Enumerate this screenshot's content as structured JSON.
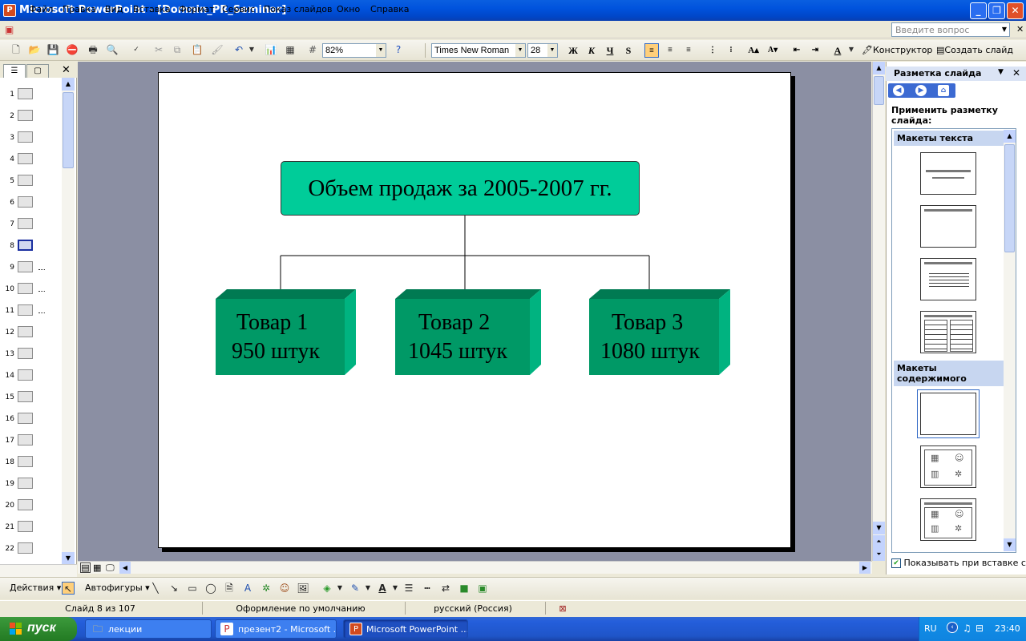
{
  "window": {
    "title": "Microsoft PowerPoint - [Domnin_PR_Seminar]"
  },
  "menu": [
    "Файл",
    "Правка",
    "Вид",
    "Вставка",
    "Формат",
    "Сервис",
    "Показ слайдов",
    "Окно",
    "Справка"
  ],
  "help_placeholder": "Введите вопрос",
  "toolbar": {
    "zoom": "82%",
    "font": "Times New Roman",
    "size": "28",
    "bold": "Ж",
    "italic": "К",
    "underline": "Ч",
    "shadow": "S",
    "designer": "Конструктор",
    "new_slide": "Создать слайд"
  },
  "outline": {
    "slides": [
      "1",
      "2",
      "3",
      "4",
      "5",
      "6",
      "7",
      "8",
      "9",
      "10",
      "11",
      "12",
      "13",
      "14",
      "15",
      "16",
      "17",
      "18",
      "19",
      "20",
      "21",
      "22"
    ],
    "selected": "8"
  },
  "slide": {
    "title": "Объем продаж за 2005-2007 гг.",
    "products": [
      {
        "name": "Товар 1",
        "qty": "950 штук"
      },
      {
        "name": "Товар 2",
        "qty": "1045 штук"
      },
      {
        "name": "Товар 3",
        "qty": "1080 штук"
      }
    ],
    "colors": {
      "title_fill": "#00cc99",
      "box_front": "#009966",
      "box_top": "#007a52",
      "box_side": "#00b380"
    }
  },
  "taskpane": {
    "title": "Разметка слайда",
    "apply_label": "Применить разметку слайда:",
    "section_text": "Макеты текста",
    "section_content": "Макеты содержимого",
    "show_on_insert": "Показывать при вставке слайдов"
  },
  "drawbar": {
    "actions": "Действия",
    "autoshapes": "Автофигуры"
  },
  "status": {
    "slide": "Слайд 8 из 107",
    "design": "Оформление по умолчанию",
    "lang": "русский (Россия)"
  },
  "taskbar": {
    "start": "пуск",
    "items": [
      "лекции",
      "презент2 - Microsoft ...",
      "Microsoft PowerPoint ..."
    ],
    "lang": "RU",
    "time": "23:40"
  }
}
